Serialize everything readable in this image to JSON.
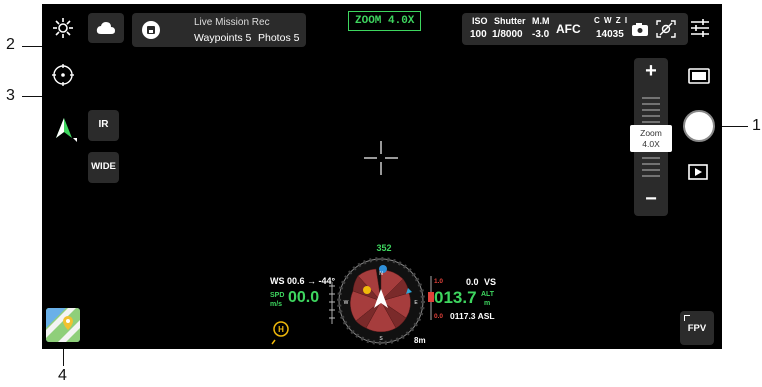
{
  "mission": {
    "title": "Live Mission Rec",
    "waypoints": "Waypoints 5",
    "photos": "Photos 5"
  },
  "zoom_badge": "ZOOM 4.0X",
  "camera": {
    "iso_label": "ISO",
    "iso_value": "100",
    "shutter_label": "Shutter",
    "shutter_value": "1/8000",
    "mm_label": "M.M",
    "mm_value": "-3.0",
    "afc": "AFC",
    "storage_label": "C W Z I",
    "storage_value": "14035"
  },
  "left": {
    "ir": "IR",
    "wide": "WIDE"
  },
  "zoom_slider": {
    "plus": "+",
    "minus": "−",
    "label_top": "Zoom",
    "label_value": "4.0X",
    "level": 0.5
  },
  "telemetry": {
    "ws": "WS 00.6 → -44°",
    "spd_label": "SPD",
    "spd_unit": "m/s",
    "spd_value": "00.0",
    "heading": "352",
    "alt_value": "013.7",
    "alt_label": "ALT",
    "alt_unit": "m",
    "vs_value": "0.0",
    "vs_label": "VS",
    "asl": "0117.3 ASL",
    "dist": "8m",
    "bar_top": "1.0",
    "bar_bottom": "0.0"
  },
  "compass": {
    "n": "N",
    "e": "E",
    "s": "S",
    "w": "W"
  },
  "fpv": "FPV",
  "callouts": {
    "c1": "1",
    "c2": "2",
    "c3": "3",
    "c4": "4"
  },
  "colors": {
    "accent_green": "#3ed65f",
    "label_green": "#6bd17a",
    "warning_red": "#e0413a",
    "shutter_white": "#ffffff"
  }
}
